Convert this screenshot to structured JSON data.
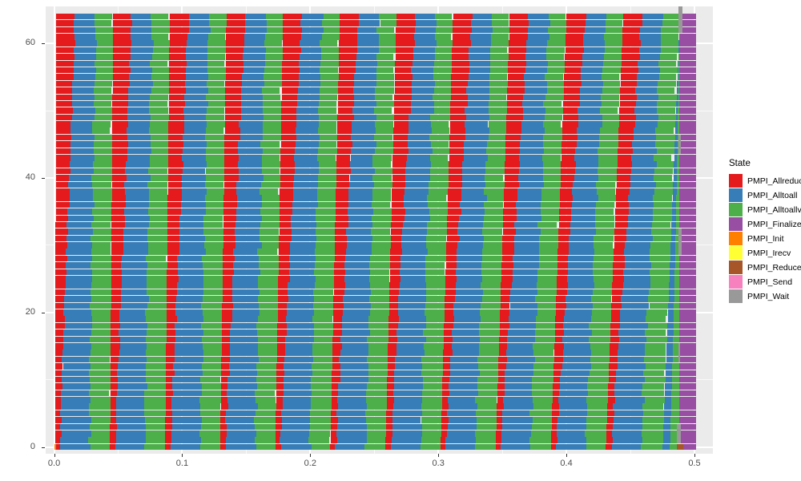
{
  "chart_data": {
    "type": "bar",
    "orientation": "horizontal",
    "stacked": true,
    "title": "",
    "xlabel": "",
    "ylabel": "",
    "xlim": [
      -0.0066,
      0.5144
    ],
    "ylim": [
      -1.0,
      65.5
    ],
    "x_ticks": [
      0.0,
      0.1,
      0.2,
      0.3,
      0.4,
      0.5
    ],
    "x_tick_labels": [
      "0.0",
      "0.1",
      "0.2",
      "0.3",
      "0.4",
      "0.5"
    ],
    "y_ticks": [
      0,
      20,
      40,
      60
    ],
    "y_tick_labels": [
      "0",
      "20",
      "40",
      "60"
    ],
    "x_minor_ticks": [
      0.05,
      0.15,
      0.25,
      0.35,
      0.45
    ],
    "y_minor_ticks": [
      10,
      30,
      50
    ],
    "grid": true,
    "legend_position": "right",
    "n_rows": 65,
    "row_start": 0,
    "row_end": 64,
    "legend_title": "State",
    "series": [
      {
        "name": "PMPI_Allreduce",
        "color": "#E41A1C"
      },
      {
        "name": "PMPI_Alltoall",
        "color": "#377EB8"
      },
      {
        "name": "PMPI_Alltoallv",
        "color": "#4DAF4A"
      },
      {
        "name": "PMPI_Finalize",
        "color": "#984EA3"
      },
      {
        "name": "PMPI_Init",
        "color": "#FF7F00"
      },
      {
        "name": "PMPI_Irecv",
        "color": "#FFFF33"
      },
      {
        "name": "PMPI_Reduce",
        "color": "#A65628"
      },
      {
        "name": "PMPI_Send",
        "color": "#F781BF"
      },
      {
        "name": "PMPI_Wait",
        "color": "#999999"
      }
    ],
    "cycle": {
      "count": 11,
      "period": 0.04425,
      "first_start": 0.0018,
      "segments_per_cycle": [
        "PMPI_Allreduce",
        "PMPI_Alltoall",
        "PMPI_Alltoallv"
      ],
      "fraction_top": [
        0.33,
        0.36,
        0.31
      ],
      "fraction_bottom": [
        0.09,
        0.52,
        0.39
      ]
    },
    "tail": {
      "finalize_start": 0.488,
      "finalize_end": 0.501,
      "wait_marks": [
        {
          "row_lo": 62,
          "row_hi": 65,
          "x0": 0.4876,
          "x1": 0.4906
        },
        {
          "row_lo": 44,
          "row_hi": 46,
          "x0": 0.4876,
          "x1": 0.4892
        },
        {
          "row_lo": 29,
          "row_hi": 32,
          "x0": 0.4876,
          "x1": 0.49
        },
        {
          "row_lo": 13,
          "row_hi": 15,
          "x0": 0.4876,
          "x1": 0.489
        },
        {
          "row_lo": 1,
          "row_hi": 3,
          "x0": 0.4862,
          "x1": 0.4896
        }
      ],
      "reduce_mark": {
        "row_lo": 0,
        "row_hi": 1,
        "x0": 0.4862,
        "x1": 0.4912
      },
      "init_mark": {
        "row_lo": 0,
        "row_hi": 1,
        "x0": 0.0,
        "x1": 0.0016
      }
    },
    "notes": "Horizontal stacked bar (Gantt-style) trace of MPI states per rank; 65 ranks on the y-axis, time in seconds on the x-axis. Eleven repeating Allreduce/Alltoall/Alltoallv phases skew progressively, ending in a Finalize block."
  },
  "legend": {
    "title": "State",
    "items": [
      {
        "label": "PMPI_Allreduce",
        "color": "#E41A1C"
      },
      {
        "label": "PMPI_Alltoall",
        "color": "#377EB8"
      },
      {
        "label": "PMPI_Alltoallv",
        "color": "#4DAF4A"
      },
      {
        "label": "PMPI_Finalize",
        "color": "#984EA3"
      },
      {
        "label": "PMPI_Init",
        "color": "#FF7F00"
      },
      {
        "label": "PMPI_Irecv",
        "color": "#FFFF33"
      },
      {
        "label": "PMPI_Reduce",
        "color": "#A65628"
      },
      {
        "label": "PMPI_Send",
        "color": "#F781BF"
      },
      {
        "label": "PMPI_Wait",
        "color": "#999999"
      }
    ]
  },
  "theme": {
    "panel_background": "#EBEBEB",
    "grid_color": "#FFFFFF",
    "plot_background": "#FFFFFF",
    "axis_text_color": "#4D4D4D",
    "legend_text_color": "#000000"
  }
}
